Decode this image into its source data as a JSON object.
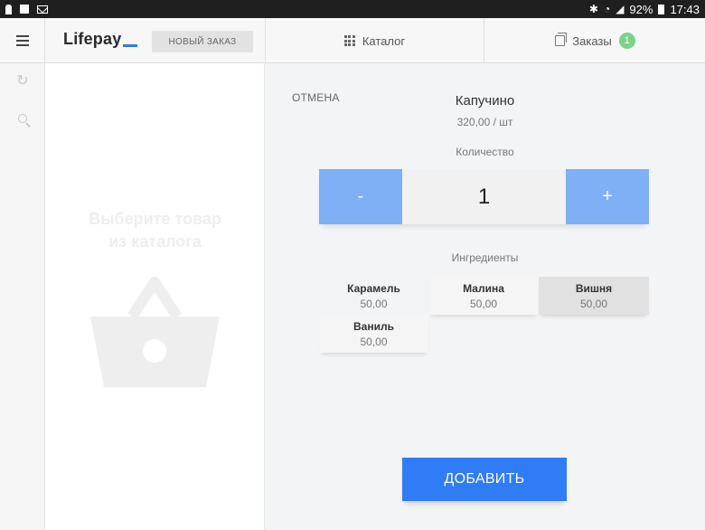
{
  "statusbar": {
    "battery": "92%",
    "time": "17:43",
    "left_icons": [
      "person-icon",
      "screenshot-icon",
      "mail-icon"
    ],
    "right_icons": [
      "bluetooth-icon",
      "wifi-icon",
      "signal-icon",
      "battery-icon"
    ]
  },
  "header": {
    "logo": "Lifepay",
    "new_order_label": "НОВЫЙ ЗАКАЗ",
    "catalog_label": "Каталог",
    "orders_label": "Заказы",
    "orders_count": "1"
  },
  "cart": {
    "empty_text": "Выберите товар\nиз каталога"
  },
  "product": {
    "cancel_label": "ОТМЕНА",
    "name": "Капучино",
    "price": "320,00 / шт",
    "quantity_label": "Количество",
    "minus_label": "-",
    "quantity": "1",
    "plus_label": "+",
    "ingredients_label": "Ингредиенты",
    "ingredients": [
      {
        "name": "Карамель",
        "price": "50,00"
      },
      {
        "name": "Малина",
        "price": "50,00"
      },
      {
        "name": "Вишня",
        "price": "50,00"
      },
      {
        "name": "Ваниль",
        "price": "50,00"
      }
    ],
    "add_label": "ДОБАВИТЬ"
  },
  "colors": {
    "accent": "#2f7cf6",
    "qty_button": "#7fb0f5",
    "badge": "#7bd389"
  }
}
